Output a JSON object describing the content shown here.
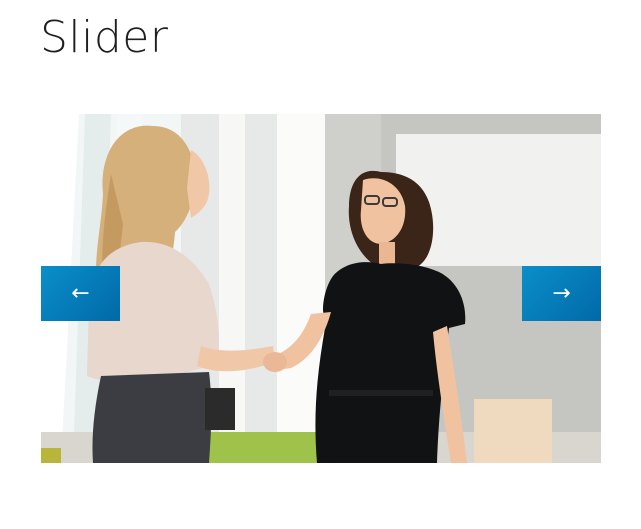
{
  "page": {
    "title": "Slider"
  },
  "slider": {
    "prev_icon": "←",
    "next_icon": "→",
    "slide_image": "two-businesswomen-shaking-hands"
  },
  "colors": {
    "accent": "#0a8fc9",
    "accent_dark": "#0169a8",
    "title_text": "#1f1f1f"
  }
}
